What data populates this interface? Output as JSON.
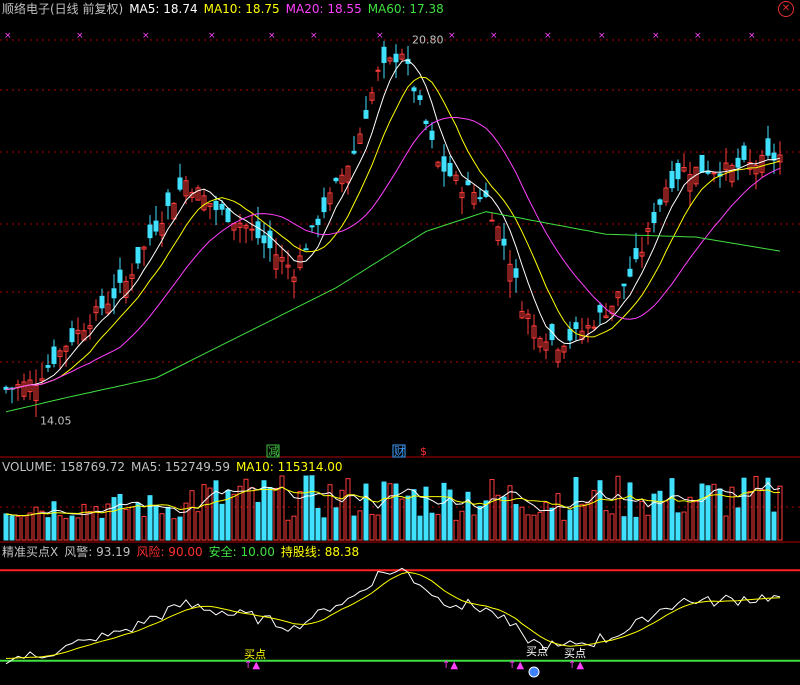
{
  "panels": {
    "price": {
      "stock_name": "顺络电子(日线 前复权)",
      "ma_labels": [
        {
          "text": "MA5: 18.74",
          "color": "#ffffff"
        },
        {
          "text": "MA10: 18.75",
          "color": "#ffff00"
        },
        {
          "text": "MA20: 18.55",
          "color": "#ff40ff"
        },
        {
          "text": "MA60: 17.38",
          "color": "#40e040"
        }
      ],
      "high_label": "20.80",
      "low_label": "14.05",
      "markers": [
        {
          "text": "减",
          "color": "#40c040",
          "type": "box"
        },
        {
          "text": "财",
          "color": "#40a0ff",
          "type": "box"
        },
        {
          "text": "$",
          "color": "#ff3030",
          "type": "text"
        }
      ]
    },
    "volume": {
      "label_volume": "VOLUME: 158769.72",
      "label_ma5": "MA5: 152749.59",
      "label_ma10": "MA10: 115314.00"
    },
    "indicator": {
      "title": "精准买点X",
      "warning_label": "风警: 93.19",
      "risk_label": "风险: 90.00",
      "safe_label": "安全: 10.00",
      "hold_label": "持股线: 88.38",
      "buy_label": "买点",
      "risk_level": 90,
      "safe_level": 10
    }
  },
  "colors": {
    "up": "#ff3c3c",
    "down": "#40e0ff",
    "ma5": "#ffffff",
    "ma10": "#ffff00",
    "ma20": "#ff40ff",
    "ma60": "#40e040",
    "grid": "#b00000"
  },
  "chart_data": {
    "type": "candlestick",
    "bars": 130,
    "price_range": [
      14.05,
      20.8
    ],
    "close_path": [
      [
        0,
        14.6
      ],
      [
        5,
        14.75
      ],
      [
        10,
        15.4
      ],
      [
        20,
        16.5
      ],
      [
        25,
        17.5
      ],
      [
        30,
        18.3
      ],
      [
        35,
        17.8
      ],
      [
        40,
        17.5
      ],
      [
        45,
        17.0
      ],
      [
        48,
        16.7
      ],
      [
        52,
        17.6
      ],
      [
        58,
        18.8
      ],
      [
        62,
        20.2
      ],
      [
        66,
        20.6
      ],
      [
        70,
        19.3
      ],
      [
        72,
        18.6
      ],
      [
        76,
        18.2
      ],
      [
        80,
        18.0
      ],
      [
        84,
        16.9
      ],
      [
        86,
        16.1
      ],
      [
        88,
        15.7
      ],
      [
        92,
        15.4
      ],
      [
        97,
        15.7
      ],
      [
        101,
        16.1
      ],
      [
        105,
        16.8
      ],
      [
        110,
        18.2
      ],
      [
        113,
        18.5
      ],
      [
        120,
        18.5
      ],
      [
        125,
        18.6
      ],
      [
        129,
        18.74
      ]
    ],
    "ma60_path": [
      [
        0,
        14.2
      ],
      [
        10,
        14.45
      ],
      [
        25,
        14.8
      ],
      [
        40,
        15.6
      ],
      [
        55,
        16.4
      ],
      [
        70,
        17.4
      ],
      [
        80,
        17.75
      ],
      [
        90,
        17.55
      ],
      [
        100,
        17.35
      ],
      [
        115,
        17.3
      ],
      [
        129,
        17.05
      ]
    ],
    "volume_mode": "generated-from-price",
    "indicator_thresholds": {
      "risk": 90.0,
      "safe": 10.0
    },
    "indicator_last": {
      "warning": 93.19,
      "hold_line": 88.38
    }
  }
}
